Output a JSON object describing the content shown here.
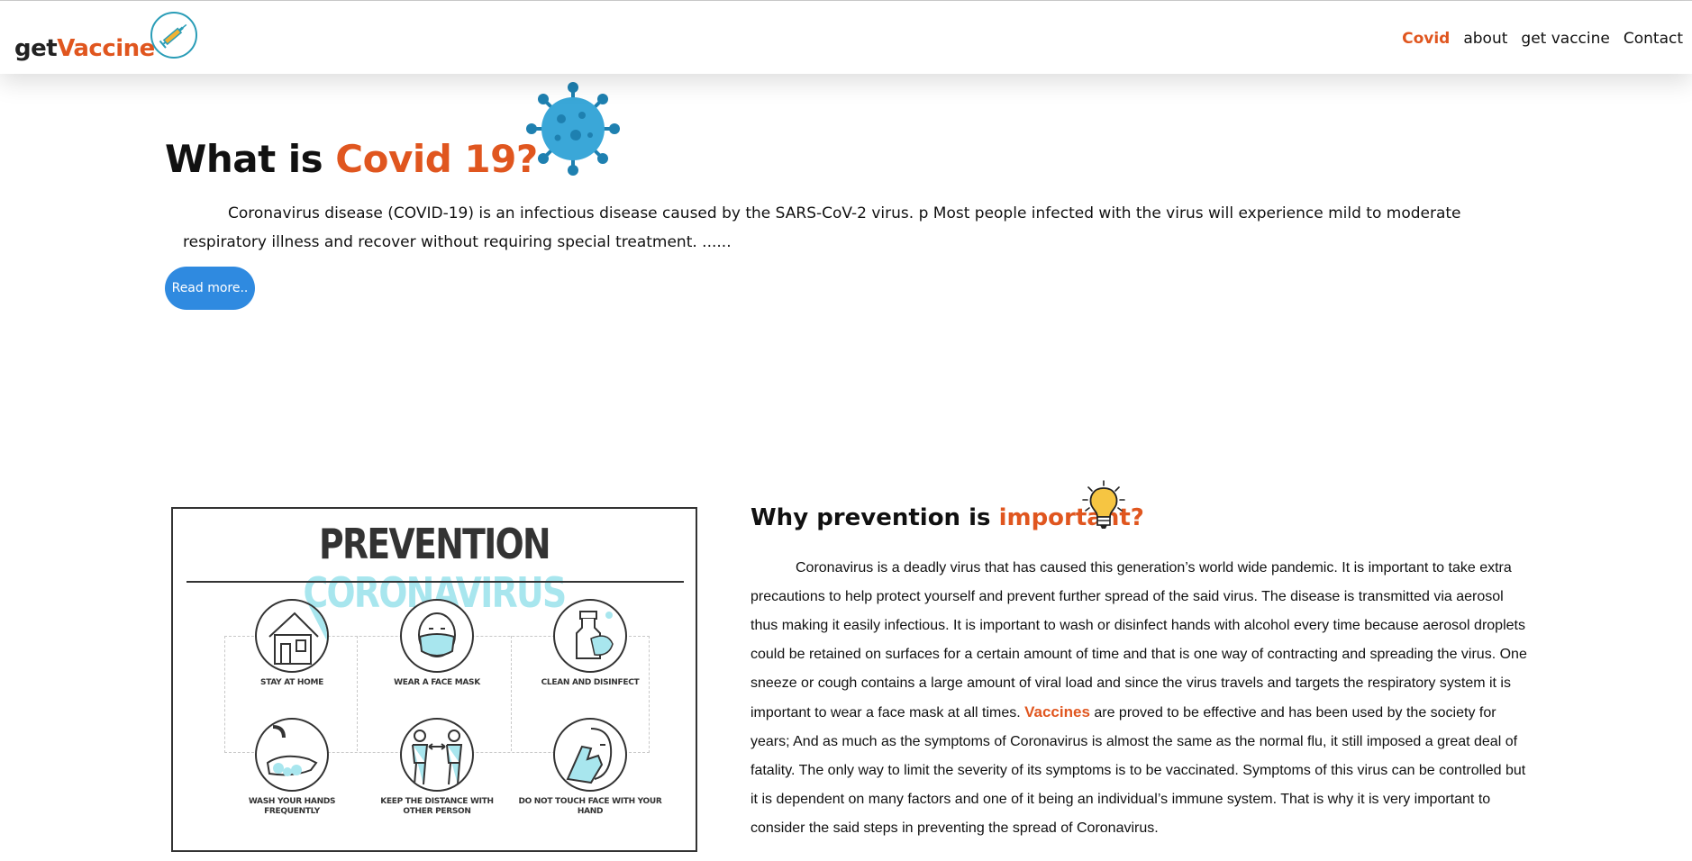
{
  "header": {
    "brand_prefix": "get",
    "brand_accent": "Vaccine",
    "nav": [
      {
        "label": "Covid",
        "active": true
      },
      {
        "label": "about",
        "active": false
      },
      {
        "label": "get vaccine",
        "active": false
      },
      {
        "label": "Contact",
        "active": false
      }
    ]
  },
  "hero": {
    "title_plain": "What is ",
    "title_accent": "Covid 19?",
    "text": "Coronavirus disease (COVID-19) is an infectious disease caused by the SARS-CoV-2 virus. p Most people infected with the virus will experience mild to moderate respiratory illness and recover without requiring special treatment. ......",
    "button_label": "Read more.."
  },
  "poster": {
    "title_dark": "PREVENTION",
    "title_light": "CORONAVIRUS",
    "items": [
      {
        "label": "STAY AT HOME",
        "icon": "home-icon"
      },
      {
        "label": "WEAR A FACE MASK",
        "icon": "face-mask-icon"
      },
      {
        "label": "CLEAN AND DISINFECT",
        "icon": "spray-bottle-icon"
      },
      {
        "label": "WASH YOUR HANDS FREQUENTLY",
        "icon": "hand-wash-icon"
      },
      {
        "label": "KEEP THE DISTANCE WITH OTHER PERSON",
        "icon": "distance-icon"
      },
      {
        "label": "DO NOT TOUCH FACE WITH YOUR HAND",
        "icon": "face-touch-icon"
      }
    ]
  },
  "why": {
    "title_plain": "Why prevention is ",
    "title_accent": "important?",
    "text_before": "Coronavirus is a deadly virus that has caused this generation’s world wide pandemic. It is important to take extra precautions to help protect yourself and prevent further spread of the said virus. The disease is transmitted via aerosol thus making it easily infectious. It is important to wash or disinfect hands with alcohol every time because aerosol droplets could be retained on surfaces for a certain amount of time and that is one way of contracting and spreading the virus. One sneeze or cough contains a large amount of viral load and since the virus travels and targets the respiratory system it is important to wear a face mask at all times. ",
    "text_highlight": "Vaccines",
    "text_after": " are proved to be effective and has been used by the society for years; And as much as the symptoms of Coronavirus is almost the same as the normal flu, it still imposed a great deal of fatality. The only way to limit the severity of its symptoms is to be vaccinated. Symptoms of this virus can be controlled but it is dependent on many factors and one of it being an individual’s immune system. That is why it is very important to consider the said steps in preventing the spread of Coronavirus."
  },
  "colors": {
    "accent": "#e0561f",
    "button": "#2f8ae0",
    "virus": "#3aa7d8",
    "poster_light": "#a8e6ee"
  }
}
